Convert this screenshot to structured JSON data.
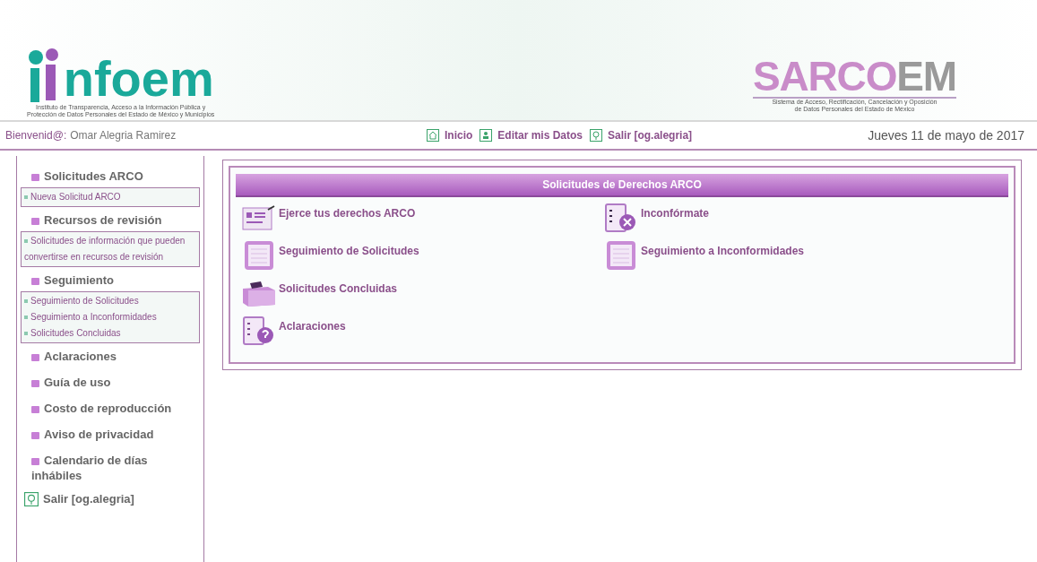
{
  "header": {
    "logo_left": {
      "letters": "nfoem",
      "caption": [
        "Instituto de Transparencia, Acceso a la Información Pública y",
        "Protección de Datos Personales del Estado de México y Municipios"
      ]
    },
    "logo_right": {
      "letters_a": "SARCO",
      "letters_b": "EM",
      "caption": [
        "Sistema de Acceso, Rectificación, Cancelación y Oposición",
        "de Datos Personales del Estado de México"
      ]
    }
  },
  "nav": {
    "welcome_label": "Bienvenid@:",
    "user": "Omar Alegria Ramirez",
    "links": [
      {
        "kind": "home",
        "label": "Inicio"
      },
      {
        "kind": "user",
        "label": "Editar mis Datos"
      },
      {
        "kind": "logout",
        "label": "Salir [og.alegria]"
      }
    ],
    "date": "Jueves 11 de mayo de 2017"
  },
  "sidebar": [
    {
      "kind": "section",
      "label": "Solicitudes ARCO",
      "links": [
        "Nueva Solicitud ARCO"
      ]
    },
    {
      "kind": "section",
      "label": "Recursos de revisión",
      "links": [
        "Solicitudes de información que pueden convertirse en recursos de revisión"
      ]
    },
    {
      "kind": "section",
      "label": "Seguimiento",
      "links": [
        "Seguimiento de Solicitudes",
        "Seguimiento a Inconformidades",
        "Solicitudes Concluidas"
      ]
    },
    {
      "kind": "section",
      "label": "Aclaraciones"
    },
    {
      "kind": "section",
      "label": "Guía de uso"
    },
    {
      "kind": "section",
      "label": "Costo de reproducción"
    },
    {
      "kind": "section",
      "label": "Aviso de privacidad"
    },
    {
      "kind": "section",
      "label": "Calendario de días inhábiles"
    },
    {
      "kind": "logout",
      "label": "Salir [og.alegria]"
    }
  ],
  "panel": {
    "title": "Solicitudes de Derechos ARCO",
    "columns": [
      [
        {
          "kind": "form",
          "label": "Ejerce tus derechos ARCO"
        },
        {
          "kind": "list",
          "label": "Seguimiento de Solicitudes"
        },
        {
          "kind": "folder",
          "label": "Solicitudes Concluidas"
        },
        {
          "kind": "question",
          "label": "Aclaraciones"
        }
      ],
      [
        {
          "kind": "reject",
          "label": "Inconfórmate"
        },
        {
          "kind": "list",
          "label": "Seguimiento a Inconformidades"
        }
      ]
    ]
  }
}
